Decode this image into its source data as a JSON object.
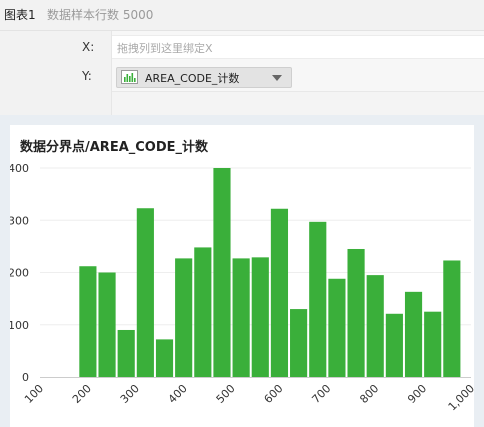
{
  "header": {
    "title": "图表1",
    "subtitle": "数据样本行数 5000"
  },
  "shelf": {
    "x_label": "X:",
    "x_placeholder": "拖拽列到这里绑定X",
    "y_label": "Y:",
    "y_pill": "AREA_CODE_计数",
    "y_pill_icon": "bar-chart-icon"
  },
  "colors": {
    "bar": "#3aaf3a",
    "accent": "#3aaf3a"
  },
  "chart_data": {
    "type": "bar",
    "title": "数据分界点/AREA_CODE_计数",
    "xlabel": "",
    "ylabel": "",
    "x": [
      200,
      240,
      280,
      320,
      360,
      400,
      440,
      480,
      520,
      560,
      600,
      640,
      680,
      720,
      760,
      800,
      840,
      880,
      920,
      960
    ],
    "values": [
      212,
      200,
      90,
      323,
      72,
      227,
      248,
      400,
      227,
      229,
      322,
      130,
      297,
      188,
      245,
      195,
      121,
      163,
      125,
      223
    ],
    "bin_width": 40,
    "xlim": [
      100,
      1000
    ],
    "ylim": [
      0,
      400
    ],
    "x_ticks": [
      100,
      200,
      300,
      400,
      500,
      600,
      700,
      800,
      900,
      1000
    ],
    "x_tick_labels": [
      "100",
      "200",
      "300",
      "400",
      "500",
      "600",
      "700",
      "800",
      "900",
      "1,000"
    ],
    "y_ticks": [
      0,
      100,
      200,
      300,
      400
    ],
    "grid": true,
    "legend": "none"
  }
}
